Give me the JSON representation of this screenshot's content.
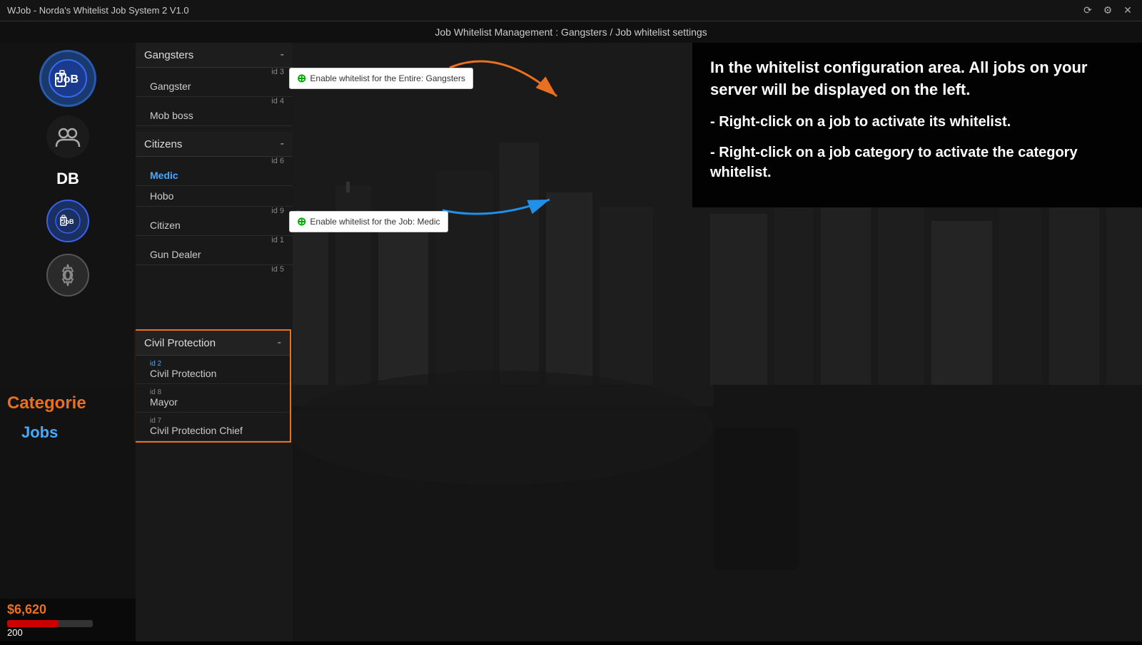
{
  "titlebar": {
    "title": "WJob - Norda's Whitelist Job System 2 V1.0",
    "controls": [
      "⟳",
      "⚙",
      "✕"
    ]
  },
  "header": {
    "title": "Job Whitelist Management : Gangsters / Job whitelist settings"
  },
  "sidebar": {
    "db_label": "DB"
  },
  "categories": [
    {
      "name": "Gangsters",
      "id": "id 3",
      "collapsed": false,
      "jobs": [
        {
          "name": "Gangster",
          "id": "id 4"
        },
        {
          "name": "Mob boss",
          "id": ""
        }
      ]
    },
    {
      "name": "Citizens",
      "id": "id 6",
      "collapsed": false,
      "jobs": [
        {
          "name": "Medic",
          "id": "",
          "active": true
        },
        {
          "name": "Hobo",
          "id": "id 9"
        },
        {
          "name": "Citizen",
          "id": "id 1"
        },
        {
          "name": "Gun Dealer",
          "id": "id 5"
        }
      ]
    }
  ],
  "civil_protection": {
    "category_name": "Civil Protection",
    "jobs": [
      {
        "name": "Civil Protection",
        "id": "id 2"
      },
      {
        "name": "Mayor",
        "id": "id 8"
      },
      {
        "name": "Civil Protection Chief",
        "id": "id 7"
      }
    ]
  },
  "tooltips": {
    "gangsters": "Enable whitelist for the Entire: Gangsters",
    "medic": "Enable whitelist for the Job: Medic"
  },
  "info_panel": {
    "intro": "In the whitelist configuration area. All jobs on your server will be displayed on the left.",
    "point1_prefix": "- Right-click on a job to activate its whitelist.",
    "point2_prefix": "- Right-click on a job category to activate the category whitelist."
  },
  "labels": {
    "categorie": "Categorie",
    "jobs": "Jobs"
  },
  "bottom": {
    "money": "$6,620",
    "health": 200
  }
}
